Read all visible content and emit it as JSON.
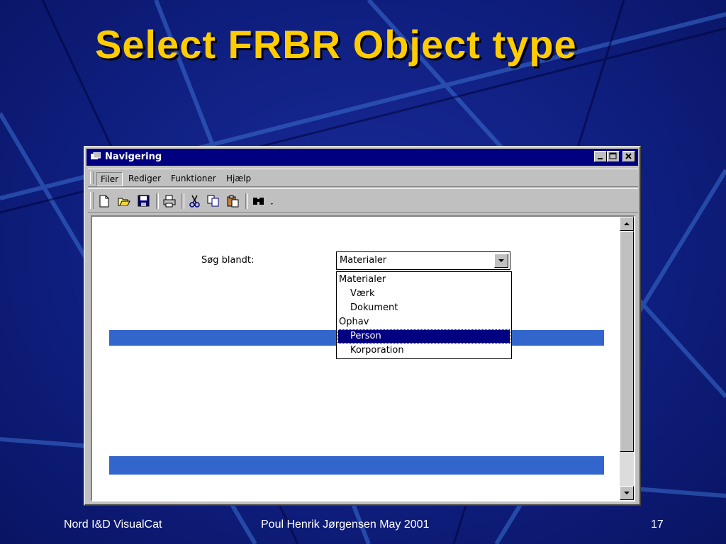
{
  "slide": {
    "title": "Select FRBR Object type",
    "footer_left": "Nord I&D VisualCat",
    "footer_center": "Poul Henrik Jørgensen May 2001",
    "page_number": "17"
  },
  "window": {
    "title": "Navigering",
    "menu": [
      "Filer",
      "Rediger",
      "Funktioner",
      "Hjælp"
    ],
    "toolbar_icons": [
      "new-icon",
      "open-icon",
      "save-icon",
      "print-icon",
      "cut-icon",
      "copy-icon",
      "paste-icon",
      "find-icon"
    ]
  },
  "search": {
    "label": "Søg blandt:",
    "selected": "Materialer",
    "options": [
      "Materialer",
      "Værk",
      "Dokument",
      "Ophav",
      "Person",
      "Korporation"
    ],
    "highlighted": "Person"
  },
  "colors": {
    "slide_title": "#ffcc00",
    "titlebar": "#000080",
    "band": "#3366cc"
  }
}
